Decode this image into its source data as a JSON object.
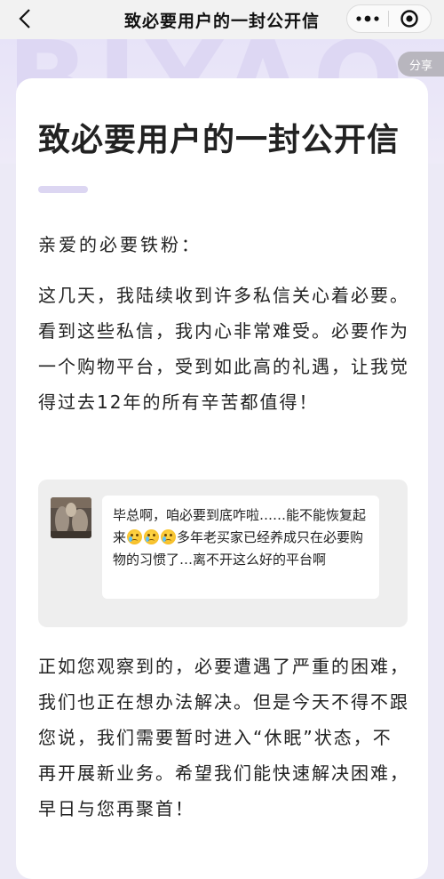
{
  "nav": {
    "title": "致必要用户的一封公开信",
    "back_icon": "chevron-left-icon",
    "more_icon": "more-dots-icon",
    "close_icon": "target-close-icon"
  },
  "hero": {
    "watermark": "BIYAO",
    "share_label": "分享"
  },
  "article": {
    "title": "致必要用户的一封公开信",
    "greeting": "亲爱的必要铁粉：",
    "paragraph1": "这几天，我陆续收到许多私信关心着必要。看到这些私信，我内心非常难受。必要作为一个购物平台，受到如此高的礼遇，让我觉得过去12年的所有辛苦都值得！",
    "quote": {
      "text_before": "毕总啊，咱必要到底咋啦……能不能恢复起来",
      "emoji_count": 3,
      "text_after": "多年老买家已经养成只在必要购物的习惯了…离不开这么好的平台啊"
    },
    "paragraph2": "正如您观察到的，必要遭遇了严重的困难，我们也正在想办法解决。但是今天不得不跟您说，我们需要暂时进入“休眠”状态，不再开展新业务。希望我们能快速解决困难，早日与您再聚首！"
  },
  "colors": {
    "accent_light": "#dcd6f2",
    "page_bg": "#eceaf6",
    "share_bg": "#b8b6be"
  }
}
